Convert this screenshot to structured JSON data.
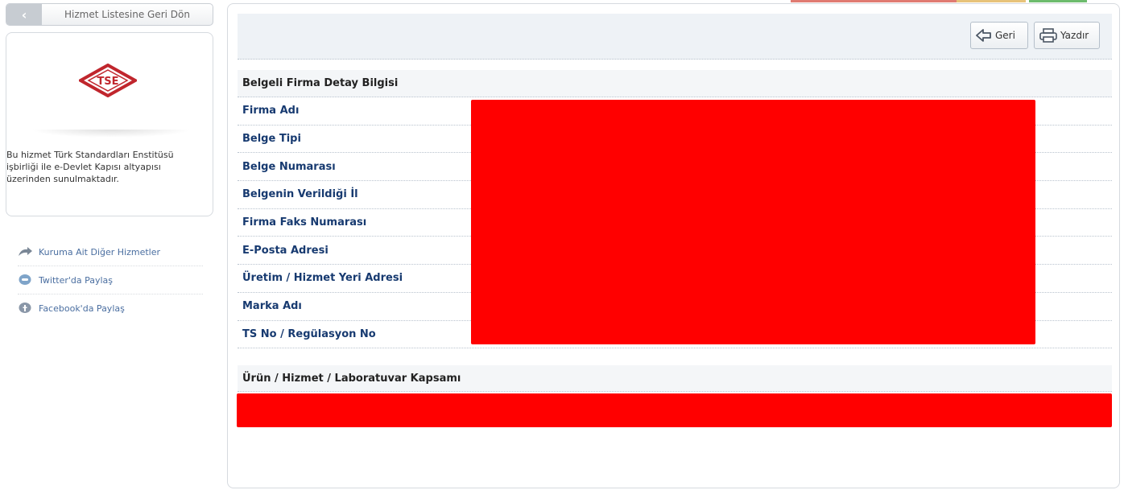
{
  "header": {
    "back_to_list_label": "Hizmet Listesine Geri Dön"
  },
  "institution": {
    "logo_text": "TSE",
    "description": "Bu hizmet Türk Standardları Enstitüsü işbirliği ile e-Devlet Kapısı altyapısı üzerinden sunulmaktadır."
  },
  "side_links": [
    {
      "label": "Kuruma Ait Diğer Hizmetler",
      "icon": "arrow-icon"
    },
    {
      "label": "Twitter'da Paylaş",
      "icon": "twitter-icon"
    },
    {
      "label": "Facebook'da Paylaş",
      "icon": "facebook-icon"
    }
  ],
  "toolbar": {
    "back_label": "Geri",
    "print_label": "Yazdır"
  },
  "details": {
    "section_title": "Belgeli Firma Detay Bilgisi",
    "rows": [
      {
        "label": "Firma Adı"
      },
      {
        "label": "Belge Tipi"
      },
      {
        "label": "Belge Numarası"
      },
      {
        "label": "Belgenin Verildiği İl"
      },
      {
        "label": "Firma Faks Numarası"
      },
      {
        "label": "E-Posta Adresi"
      },
      {
        "label": "Üretim / Hizmet Yeri Adresi"
      },
      {
        "label": "Marka Adı"
      },
      {
        "label": "TS No / Regülasyon No"
      }
    ]
  },
  "scope": {
    "section_title": "Ürün / Hizmet / Laboratuvar Kapsamı"
  },
  "colors": {
    "label_blue": "#173a70",
    "link_blue": "#4a6ea0",
    "redaction": "#ff0000",
    "tse_red": "#c0262d"
  }
}
